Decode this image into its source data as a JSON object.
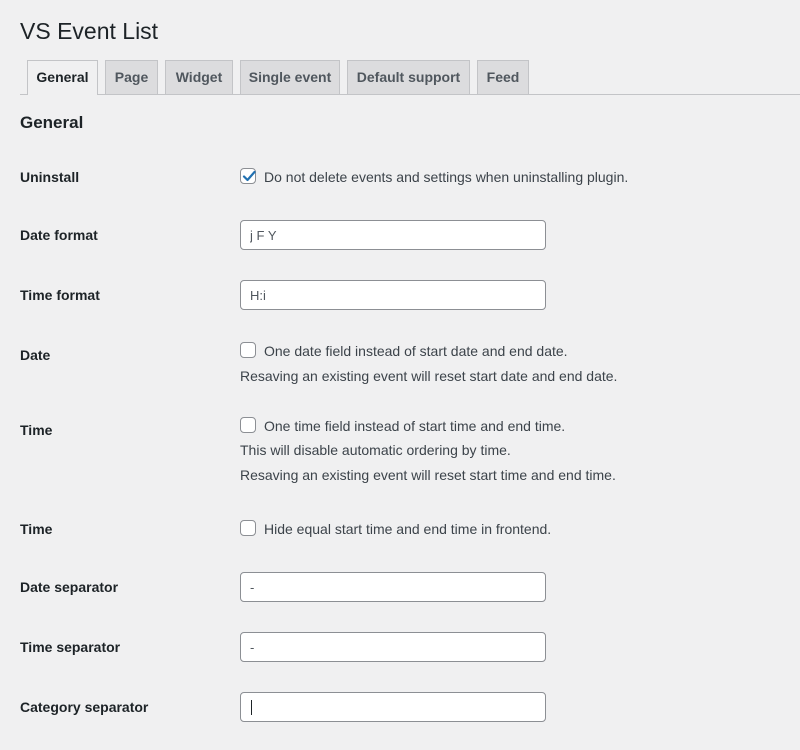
{
  "page": {
    "title": "VS Event List"
  },
  "tabs": [
    {
      "label": "General",
      "active": true
    },
    {
      "label": "Page",
      "active": false
    },
    {
      "label": "Widget",
      "active": false
    },
    {
      "label": "Single event",
      "active": false
    },
    {
      "label": "Default support",
      "active": false
    },
    {
      "label": "Feed",
      "active": false
    }
  ],
  "section": {
    "title": "General"
  },
  "fields": {
    "uninstall": {
      "label": "Uninstall",
      "checked": true,
      "checkbox_label": "Do not delete events and settings when uninstalling plugin."
    },
    "date_format": {
      "label": "Date format",
      "value": "j F Y"
    },
    "time_format": {
      "label": "Time format",
      "value": "H:i"
    },
    "date": {
      "label": "Date",
      "checked": false,
      "checkbox_label": "One date field instead of start date and end date.",
      "description": "Resaving an existing event will reset start date and end date."
    },
    "time": {
      "label": "Time",
      "checked": false,
      "checkbox_label": "One time field instead of start time and end time.",
      "description_1": "This will disable automatic ordering by time.",
      "description_2": "Resaving an existing event will reset start time and end time."
    },
    "time_hide": {
      "label": "Time",
      "checked": false,
      "checkbox_label": "Hide equal start time and end time in frontend."
    },
    "date_separator": {
      "label": "Date separator",
      "value": "-"
    },
    "time_separator": {
      "label": "Time separator",
      "value": "-"
    },
    "category_separator": {
      "label": "Category separator",
      "value": ""
    }
  },
  "icons": {
    "checkmark": "checkmark-icon",
    "check_color": "#2271b1"
  }
}
